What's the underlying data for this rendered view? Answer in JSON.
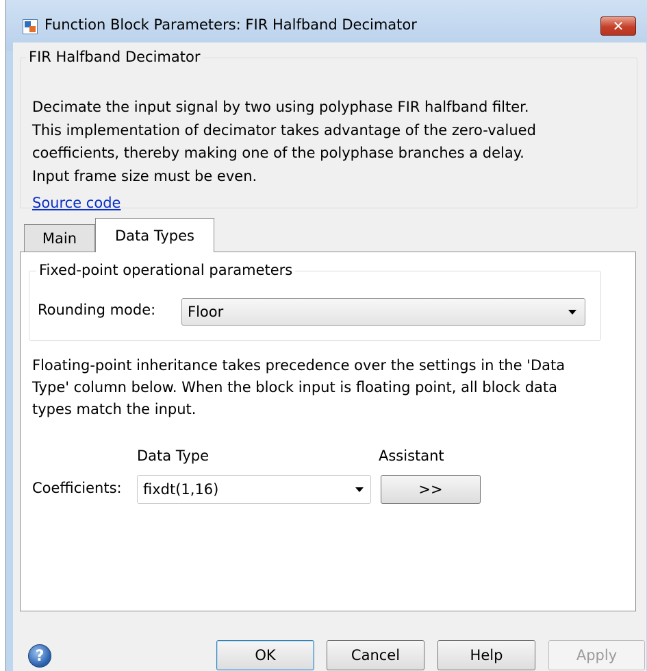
{
  "window": {
    "title": "Function Block Parameters: FIR Halfband Decimator",
    "close_icon": "close-icon"
  },
  "block": {
    "name": "FIR Halfband Decimator",
    "description": [
      "Decimate the input signal by two using polyphase FIR halfband filter.",
      "This implementation of decimator takes advantage of the zero-valued",
      "coefficients, thereby making one of the polyphase branches a delay.",
      "Input frame size must be even."
    ],
    "source_link": "Source code"
  },
  "tabs": [
    {
      "label": "Main",
      "active": false
    },
    {
      "label": "Data Types",
      "active": true
    }
  ],
  "fixed_point": {
    "group_title": "Fixed-point operational parameters",
    "rounding_label": "Rounding mode:",
    "rounding_value": "Floor"
  },
  "inheritance_text": [
    "Floating-point inheritance takes precedence over the settings in the 'Data",
    "Type' column below. When the block input is floating point, all block data",
    "types match the input."
  ],
  "datatype_table": {
    "col_datatype": "Data Type",
    "col_assistant": "Assistant",
    "row_label": "Coefficients:",
    "row_value": "fixdt(1,16)",
    "assistant_button": ">>"
  },
  "buttons": {
    "ok": "OK",
    "cancel": "Cancel",
    "help": "Help",
    "apply": "Apply",
    "apply_enabled": false
  },
  "colors": {
    "frame": "#bfd6ef",
    "link": "#0b2ec9",
    "close": "#c4402a"
  }
}
